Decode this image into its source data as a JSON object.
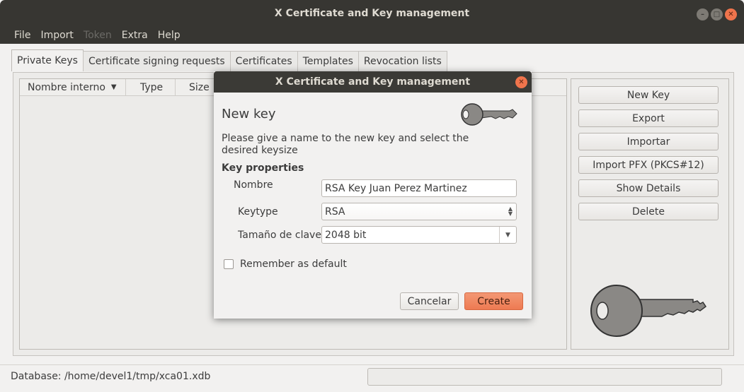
{
  "window": {
    "title": "X Certificate and Key management"
  },
  "menu": [
    {
      "label": "File",
      "disabled": false
    },
    {
      "label": "Import",
      "disabled": false
    },
    {
      "label": "Token",
      "disabled": true
    },
    {
      "label": "Extra",
      "disabled": false
    },
    {
      "label": "Help",
      "disabled": false
    }
  ],
  "tabs": [
    "Private Keys",
    "Certificate signing requests",
    "Certificates",
    "Templates",
    "Revocation lists"
  ],
  "table": {
    "columns": [
      "Nombre interno",
      "Type",
      "Size"
    ]
  },
  "side_buttons": [
    "New Key",
    "Export",
    "Importar",
    "Import PFX (PKCS#12)",
    "Show Details",
    "Delete"
  ],
  "status": {
    "database": "Database: /home/devel1/tmp/xca01.xdb"
  },
  "dialog": {
    "title": "X Certificate and Key management",
    "heading": "New key",
    "description": "Please give a name to the new key and select the desired keysize",
    "section": "Key properties",
    "name_label": "Nombre",
    "name_value": "RSA Key Juan Perez Martinez",
    "keytype_label": "Keytype",
    "keytype_value": "RSA",
    "keysize_label": "Tamaño de clave",
    "keysize_value": "2048 bit",
    "remember_label": "Remember as default",
    "remember_checked": false,
    "cancel_label": "Cancelar",
    "create_label": "Create"
  },
  "colors": {
    "titlebar": "#373632",
    "accent": "#ee7a52",
    "close": "#f0744c"
  }
}
